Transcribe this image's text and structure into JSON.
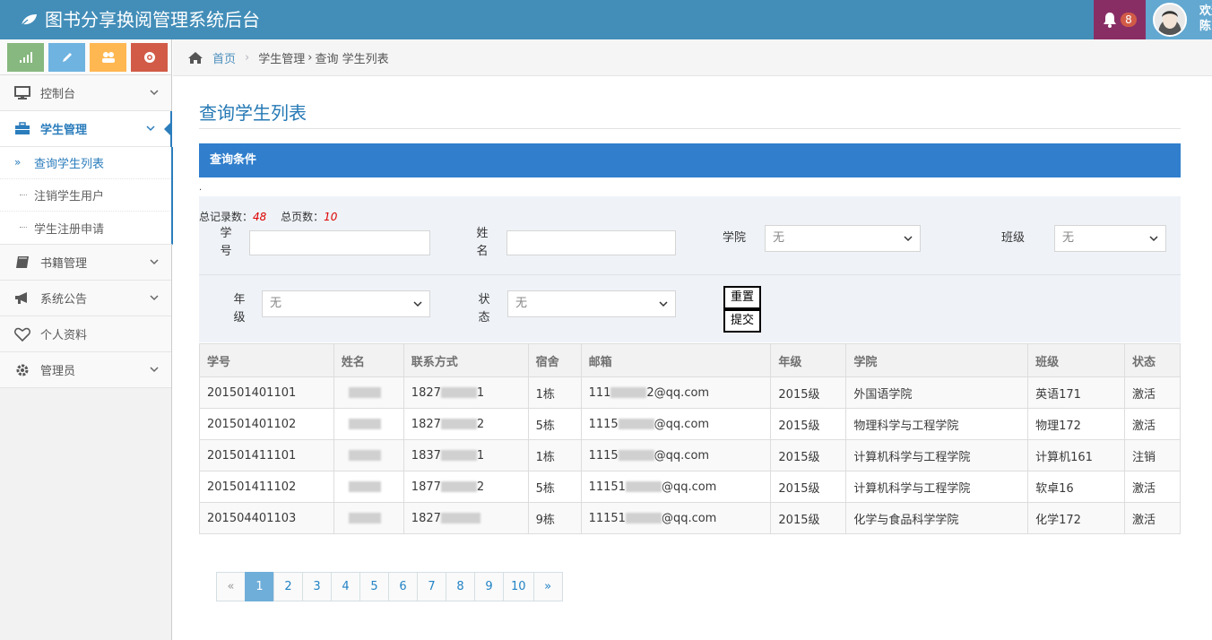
{
  "app": {
    "title": "图书分享换阅管理系统后台"
  },
  "header": {
    "notification_count": "8",
    "user_text_line1": "欢迎",
    "user_text_line2": "陈"
  },
  "sidebar": {
    "items": [
      {
        "label": "控制台",
        "icon": "desktop-icon"
      },
      {
        "label": "学生管理",
        "icon": "briefcase-icon"
      },
      {
        "label": "书籍管理",
        "icon": "book-icon"
      },
      {
        "label": "系统公告",
        "icon": "bullhorn-icon"
      },
      {
        "label": "个人资料",
        "icon": "heart-icon"
      },
      {
        "label": "管理员",
        "icon": "gear-icon"
      }
    ],
    "submenu": [
      {
        "label": "查询学生列表"
      },
      {
        "label": "注销学生用户"
      },
      {
        "label": "学生注册申请"
      }
    ]
  },
  "breadcrumb": {
    "home": "首页",
    "section": "学生管理",
    "current": "查询 学生列表"
  },
  "page": {
    "title": "查询学生列表"
  },
  "query": {
    "header": "查询条件",
    "total_records_label": "总记录数：",
    "total_records": "48",
    "total_pages_label": "总页数：",
    "total_pages": "10",
    "student_id_label_1": "学",
    "student_id_label_2": "号",
    "name_label_1": "姓",
    "name_label_2": "名",
    "college_label": "学院",
    "college_value": "无",
    "class_label": "班级",
    "class_value": "无",
    "grade_label_1": "年",
    "grade_label_2": "级",
    "grade_value": "无",
    "status_label_1": "状",
    "status_label_2": "态",
    "status_value": "无",
    "reset_label": "重置",
    "submit_label": "提交"
  },
  "table": {
    "headers": [
      "学号",
      "姓名",
      "联系方式",
      "宿舍",
      "邮箱",
      "年级",
      "学院",
      "班级",
      "状态"
    ],
    "rows": [
      {
        "id": "201501401101",
        "name": "",
        "phone_prefix": "1827",
        "phone_suffix": "1",
        "dorm": "1栋",
        "email_prefix": "111",
        "email_suffix": "2@qq.com",
        "grade": "2015级",
        "college": "外国语学院",
        "class": "英语171",
        "status": "激活"
      },
      {
        "id": "201501401102",
        "name": "",
        "phone_prefix": "1827",
        "phone_suffix": "2",
        "dorm": "5栋",
        "email_prefix": "1115",
        "email_suffix": "@qq.com",
        "grade": "2015级",
        "college": "物理科学与工程学院",
        "class": "物理172",
        "status": "激活"
      },
      {
        "id": "201501411101",
        "name": "",
        "phone_prefix": "1837",
        "phone_suffix": "1",
        "dorm": "1栋",
        "email_prefix": "1115",
        "email_suffix": "@qq.com",
        "grade": "2015级",
        "college": "计算机科学与工程学院",
        "class": "计算机161",
        "status": "注销"
      },
      {
        "id": "201501411102",
        "name": "",
        "phone_prefix": "1877",
        "phone_suffix": "2",
        "dorm": "5栋",
        "email_prefix": "11151",
        "email_suffix": "@qq.com",
        "grade": "2015级",
        "college": "计算机科学与工程学院",
        "class": "软卓16",
        "status": "激活"
      },
      {
        "id": "201504401103",
        "name": "",
        "phone_prefix": "1827",
        "phone_suffix": "",
        "dorm": "9栋",
        "email_prefix": "11151",
        "email_suffix": "@qq.com",
        "grade": "2015级",
        "college": "化学与食品科学学院",
        "class": "化学172",
        "status": "激活"
      }
    ]
  },
  "pagination": {
    "prev": "«",
    "next": "»",
    "pages": [
      "1",
      "2",
      "3",
      "4",
      "5",
      "6",
      "7",
      "8",
      "9",
      "10"
    ]
  }
}
